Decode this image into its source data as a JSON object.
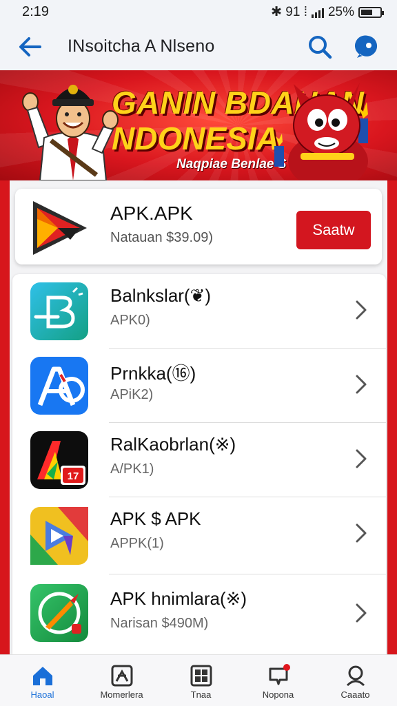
{
  "status_bar": {
    "time": "2:19",
    "indicators": "✱ 91 ⁞",
    "battery_text": "25%",
    "battery_level": 0.6
  },
  "app_bar": {
    "title": "INsoitcha A Nlseno",
    "icons": [
      "back-arrow-icon",
      "search-icon",
      "help-icon"
    ]
  },
  "banner": {
    "line1": "GANIN BDAHAN",
    "line2": "NDONESIA",
    "subtitle": "Naqpiae Benlae S",
    "colors": {
      "background": "#d9161e",
      "headline": "#ffd21a"
    }
  },
  "featured": {
    "name": "APK.APK",
    "price": "Natauan $39.09)",
    "button_label": "Saatw",
    "accent": "#d3161f"
  },
  "apps": [
    {
      "name": "Balnkslar(❦)",
      "sub": "APK0)",
      "icon": "app-b-icon"
    },
    {
      "name": "Prnkka(⑯)",
      "sub": "APiK2)",
      "icon": "app-a-blue-icon"
    },
    {
      "name": "RalKaobrlan(※)",
      "sub": "A/PK1)",
      "icon": "app-a-dark-icon",
      "badge": "17"
    },
    {
      "name": "APK $ APK",
      "sub": "APPK(1)",
      "icon": "app-play-icon"
    },
    {
      "name": "APK hnimlara(※)",
      "sub": "Narisan $490M)",
      "icon": "app-compass-icon"
    }
  ],
  "bottom_nav": [
    {
      "label": "Haoal",
      "icon": "home-icon",
      "active": true
    },
    {
      "label": "Momerlera",
      "icon": "apps-icon",
      "active": false
    },
    {
      "label": "Tnaa",
      "icon": "grid-icon",
      "active": false
    },
    {
      "label": "Nopona",
      "icon": "notification-icon",
      "active": false
    },
    {
      "label": "Caaato",
      "icon": "profile-search-icon",
      "active": false
    }
  ],
  "colors": {
    "accent_blue": "#1a6fd8",
    "brand_red": "#d7161c"
  }
}
